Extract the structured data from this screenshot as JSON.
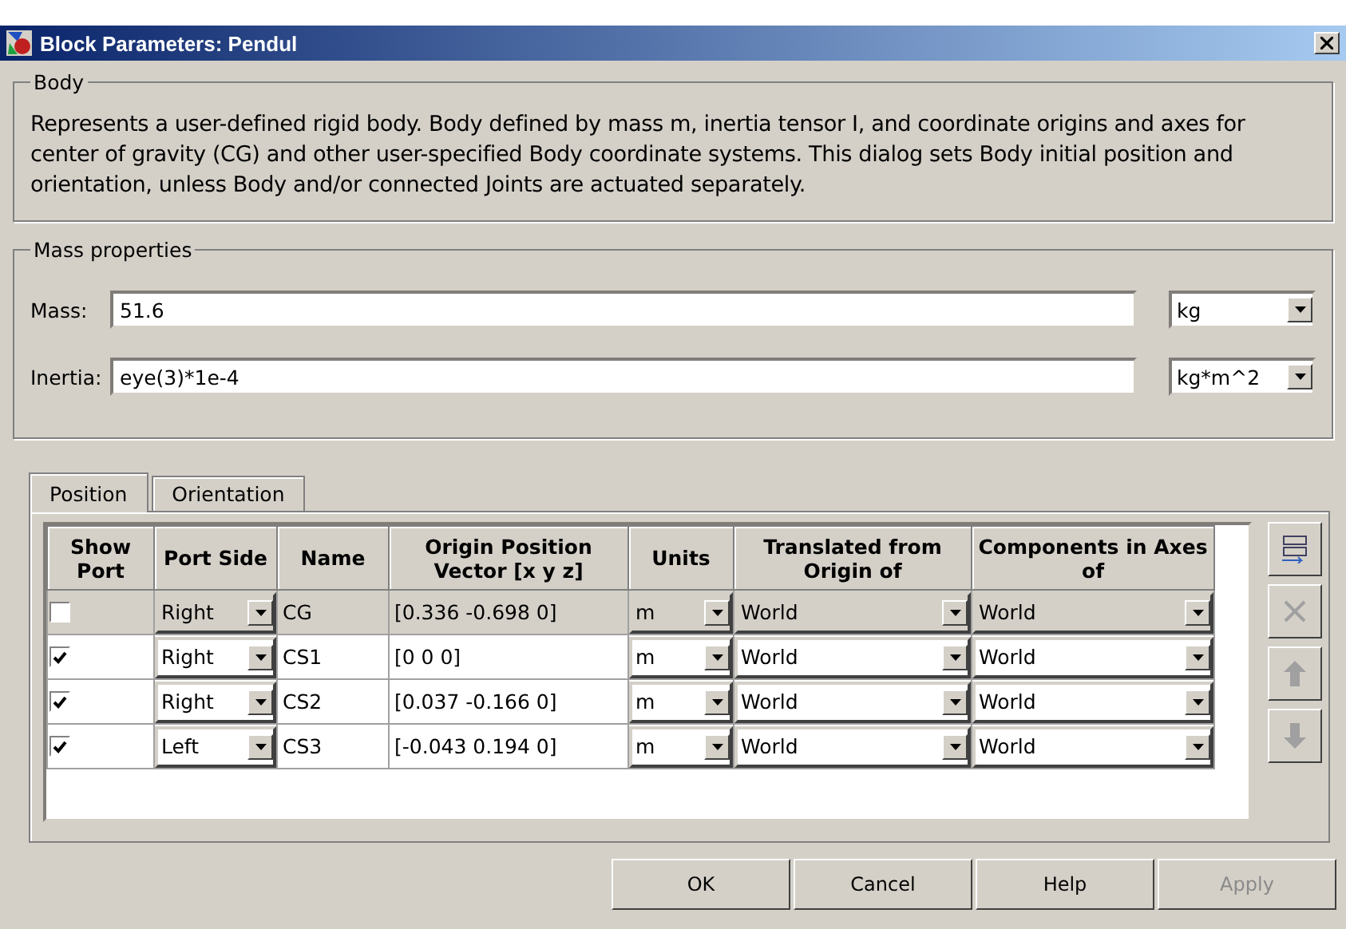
{
  "window": {
    "title": "Block Parameters: Pendul"
  },
  "body": {
    "legend": "Body",
    "description": "Represents a user-defined rigid body. Body defined by mass m, inertia tensor I, and coordinate origins and axes for center of gravity (CG) and other user-specified Body coordinate systems. This dialog sets Body initial position and orientation, unless Body and/or connected Joints are actuated separately."
  },
  "mass_properties": {
    "legend": "Mass properties",
    "fields": [
      {
        "label": "Mass:",
        "value": "51.6",
        "unit": "kg"
      },
      {
        "label": "Inertia:",
        "value": "eye(3)*1e-4",
        "unit": "kg*m^2"
      }
    ]
  },
  "tabs": [
    {
      "label": "Position",
      "selected": true
    },
    {
      "label": "Orientation",
      "selected": false
    }
  ],
  "table": {
    "columns": [
      "Show Port",
      "Port Side",
      "Name",
      "Origin Position Vector [x y z]",
      "Units",
      "Translated from Origin of",
      "Components in Axes of"
    ],
    "rows": [
      {
        "show_port": false,
        "selected": true,
        "port_side": "Right",
        "name": "CG",
        "vector": "[0.336 -0.698 0]",
        "units": "m",
        "translated_from": "World",
        "components_in": "World"
      },
      {
        "show_port": true,
        "selected": false,
        "port_side": "Right",
        "name": "CS1",
        "vector": "[0 0 0]",
        "units": "m",
        "translated_from": "World",
        "components_in": "World"
      },
      {
        "show_port": true,
        "selected": false,
        "port_side": "Right",
        "name": "CS2",
        "vector": "[0.037 -0.166 0]",
        "units": "m",
        "translated_from": "World",
        "components_in": "World"
      },
      {
        "show_port": true,
        "selected": false,
        "port_side": "Left",
        "name": "CS3",
        "vector": "[-0.043 0.194 0]",
        "units": "m",
        "translated_from": "World",
        "components_in": "World"
      }
    ]
  },
  "side_buttons": [
    {
      "kind": "add",
      "disabled": false
    },
    {
      "kind": "delete",
      "disabled": true
    },
    {
      "kind": "up",
      "disabled": true
    },
    {
      "kind": "down",
      "disabled": true
    }
  ],
  "buttons": [
    {
      "label": "OK",
      "disabled": false
    },
    {
      "label": "Cancel",
      "disabled": false
    },
    {
      "label": "Help",
      "disabled": false
    },
    {
      "label": "Apply",
      "disabled": true
    }
  ]
}
